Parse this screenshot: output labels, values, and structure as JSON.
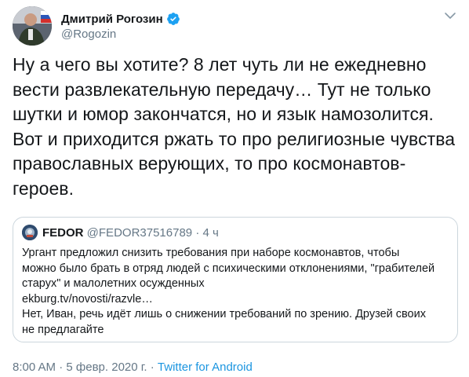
{
  "tweet": {
    "author_name": "Дмитрий Рогозин",
    "handle": "@Rogozin",
    "verified": true,
    "text_lines": [
      "Ну а чего вы хотите? 8 лет чуть ли не ежедневно",
      "вести развлекательную передачу… Тут не только",
      "шутки и юмор закончатся, но и язык намозолится.",
      "Вот и приходится ржать то про религиозные чувства",
      "православных верующих, то про космонавтов-",
      "героев."
    ]
  },
  "quoted": {
    "author_name": "FEDOR",
    "handle": "@FEDOR37516789",
    "separator": "·",
    "age": "4 ч",
    "lines": [
      "Ургант предложил снизить требования при наборе космонавтов, чтобы",
      "можно было брать в отряд людей с психическими отклонениями, \"грабителей",
      "старух\" и малолетних осужденных",
      "ekburg.tv/novosti/razvle…",
      "Нет, Иван, речь идёт лишь о снижении требований по зрению. Друзей своих",
      "не предлагайте"
    ]
  },
  "footer": {
    "time": "8:00 AM",
    "separator1": "·",
    "date": "5 февр. 2020 г.",
    "separator2": "·",
    "source": "Twitter for Android"
  },
  "colors": {
    "text": "#14171a",
    "secondary": "#657786",
    "accent": "#1b95e0",
    "border": "#ccd6dd"
  },
  "icons": {
    "verified": "verified-badge-icon",
    "caret": "chevron-down-icon"
  }
}
